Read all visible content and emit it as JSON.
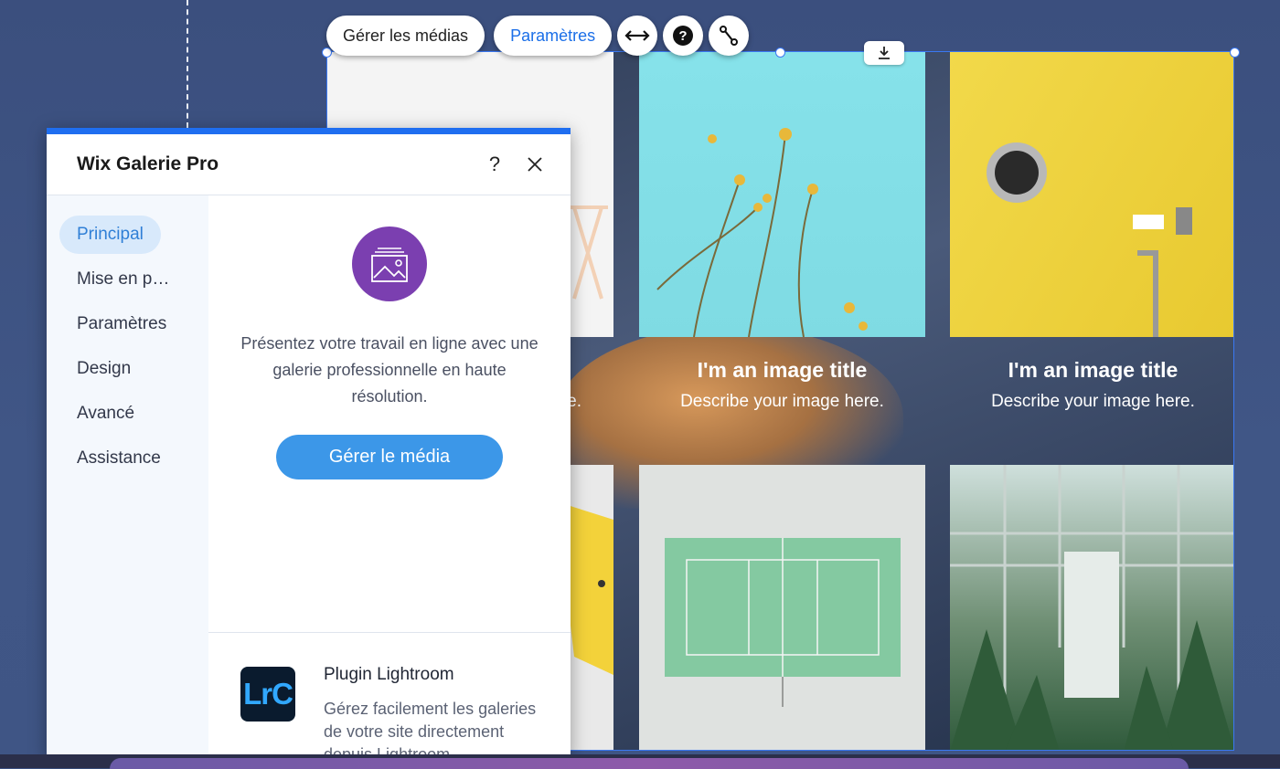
{
  "toolbar": {
    "manage_media_label": "Gérer les médias",
    "settings_label": "Paramètres",
    "icons": [
      "stretch-icon",
      "help-icon",
      "connect-icon"
    ]
  },
  "gallery": {
    "download_icon": "download-icon",
    "items": [
      {
        "title": "I'm an image title",
        "description": "Describe your image here."
      },
      {
        "title": "I'm an image title",
        "description": "Describe your image here."
      }
    ],
    "partial_description": "e."
  },
  "panel": {
    "title": "Wix Galerie Pro",
    "help_label": "?",
    "close_icon": "close-icon",
    "nav": [
      {
        "label": "Principal",
        "active": true
      },
      {
        "label": "Mise en p…"
      },
      {
        "label": "Paramètres"
      },
      {
        "label": "Design"
      },
      {
        "label": "Avancé"
      },
      {
        "label": "Assistance"
      }
    ],
    "main": {
      "icon": "gallery-image-icon",
      "description": "Présentez votre travail en ligne avec une galerie professionnelle en haute résolution.",
      "button_label": "Gérer le média"
    },
    "plugin": {
      "logo_text": "LrC",
      "title": "Plugin Lightroom",
      "description": "Gérez facilement les galeries de votre site directement depuis Lightroom"
    }
  },
  "colors": {
    "accent": "#1b6fe8",
    "panel_top_bar": "#1f6ef0",
    "button": "#3c97e8",
    "icon_circle": "#7b3fb0",
    "selection": "#3a78f2"
  }
}
